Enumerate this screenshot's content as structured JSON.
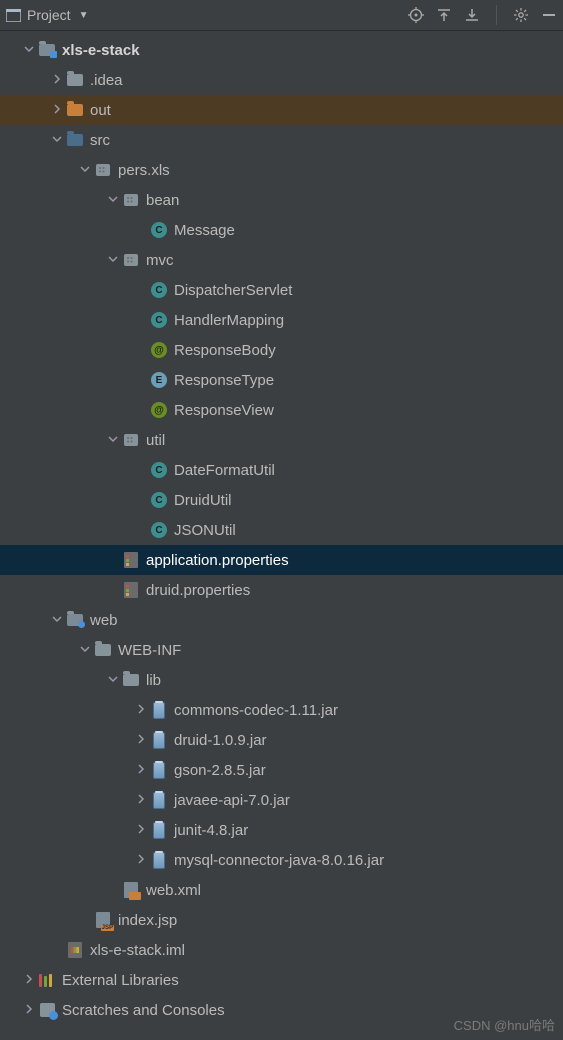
{
  "toolbar": {
    "title": "Project",
    "icons": [
      "locate-icon",
      "expand-all-icon",
      "collapse-all-icon",
      "settings-icon",
      "hide-icon"
    ]
  },
  "tree": [
    {
      "d": 0,
      "a": "open",
      "i": "module",
      "t": "xls-e-stack",
      "bold": true,
      "name": "project-root"
    },
    {
      "d": 1,
      "a": "closed",
      "i": "folder",
      "t": ".idea",
      "name": "folder-idea"
    },
    {
      "d": 1,
      "a": "closed",
      "i": "folder-orange",
      "t": "out",
      "name": "folder-out",
      "hov": true
    },
    {
      "d": 1,
      "a": "open",
      "i": "folder-blue",
      "t": "src",
      "name": "folder-src"
    },
    {
      "d": 2,
      "a": "open",
      "i": "pkg",
      "t": "pers.xls",
      "name": "package-pers-xls"
    },
    {
      "d": 3,
      "a": "open",
      "i": "pkg",
      "t": "bean",
      "name": "package-bean"
    },
    {
      "d": 4,
      "a": "",
      "i": "class",
      "t": "Message",
      "name": "class-message"
    },
    {
      "d": 3,
      "a": "open",
      "i": "pkg",
      "t": "mvc",
      "name": "package-mvc"
    },
    {
      "d": 4,
      "a": "",
      "i": "class",
      "t": "DispatcherServlet",
      "name": "class-dispatcherservlet"
    },
    {
      "d": 4,
      "a": "",
      "i": "class",
      "t": "HandlerMapping",
      "name": "class-handlermapping"
    },
    {
      "d": 4,
      "a": "",
      "i": "anno",
      "t": "ResponseBody",
      "name": "anno-responsebody"
    },
    {
      "d": 4,
      "a": "",
      "i": "enum",
      "t": "ResponseType",
      "name": "enum-responsetype"
    },
    {
      "d": 4,
      "a": "",
      "i": "anno",
      "t": "ResponseView",
      "name": "anno-responseview"
    },
    {
      "d": 3,
      "a": "open",
      "i": "pkg",
      "t": "util",
      "name": "package-util"
    },
    {
      "d": 4,
      "a": "",
      "i": "class",
      "t": "DateFormatUtil",
      "name": "class-dateformatutil"
    },
    {
      "d": 4,
      "a": "",
      "i": "class",
      "t": "DruidUtil",
      "name": "class-druidutil"
    },
    {
      "d": 4,
      "a": "",
      "i": "class",
      "t": "JSONUtil",
      "name": "class-jsonutil"
    },
    {
      "d": 3,
      "a": "",
      "i": "props",
      "t": "application.properties",
      "name": "file-application-properties",
      "sel": true
    },
    {
      "d": 3,
      "a": "",
      "i": "props",
      "t": "druid.properties",
      "name": "file-druid-properties"
    },
    {
      "d": 1,
      "a": "open",
      "i": "webroot",
      "t": "web",
      "name": "folder-web"
    },
    {
      "d": 2,
      "a": "open",
      "i": "folder",
      "t": "WEB-INF",
      "name": "folder-webinf"
    },
    {
      "d": 3,
      "a": "open",
      "i": "folder",
      "t": "lib",
      "name": "folder-lib"
    },
    {
      "d": 4,
      "a": "closed",
      "i": "jar",
      "t": "commons-codec-1.11.jar",
      "name": "jar-commons-codec"
    },
    {
      "d": 4,
      "a": "closed",
      "i": "jar",
      "t": "druid-1.0.9.jar",
      "name": "jar-druid"
    },
    {
      "d": 4,
      "a": "closed",
      "i": "jar",
      "t": "gson-2.8.5.jar",
      "name": "jar-gson"
    },
    {
      "d": 4,
      "a": "closed",
      "i": "jar",
      "t": "javaee-api-7.0.jar",
      "name": "jar-javaee-api"
    },
    {
      "d": 4,
      "a": "closed",
      "i": "jar",
      "t": "junit-4.8.jar",
      "name": "jar-junit"
    },
    {
      "d": 4,
      "a": "closed",
      "i": "jar",
      "t": "mysql-connector-java-8.0.16.jar",
      "name": "jar-mysql-connector"
    },
    {
      "d": 3,
      "a": "",
      "i": "xml",
      "t": "web.xml",
      "name": "file-web-xml"
    },
    {
      "d": 2,
      "a": "",
      "i": "jsp",
      "t": "index.jsp",
      "name": "file-index-jsp"
    },
    {
      "d": 1,
      "a": "",
      "i": "iml",
      "t": "xls-e-stack.iml",
      "name": "file-iml"
    },
    {
      "d": 0,
      "a": "closed",
      "i": "lib",
      "t": "External Libraries",
      "name": "external-libraries"
    },
    {
      "d": 0,
      "a": "closed",
      "i": "scratch",
      "t": "Scratches and Consoles",
      "name": "scratches-consoles"
    }
  ],
  "watermark": "CSDN @hnu哈哈"
}
